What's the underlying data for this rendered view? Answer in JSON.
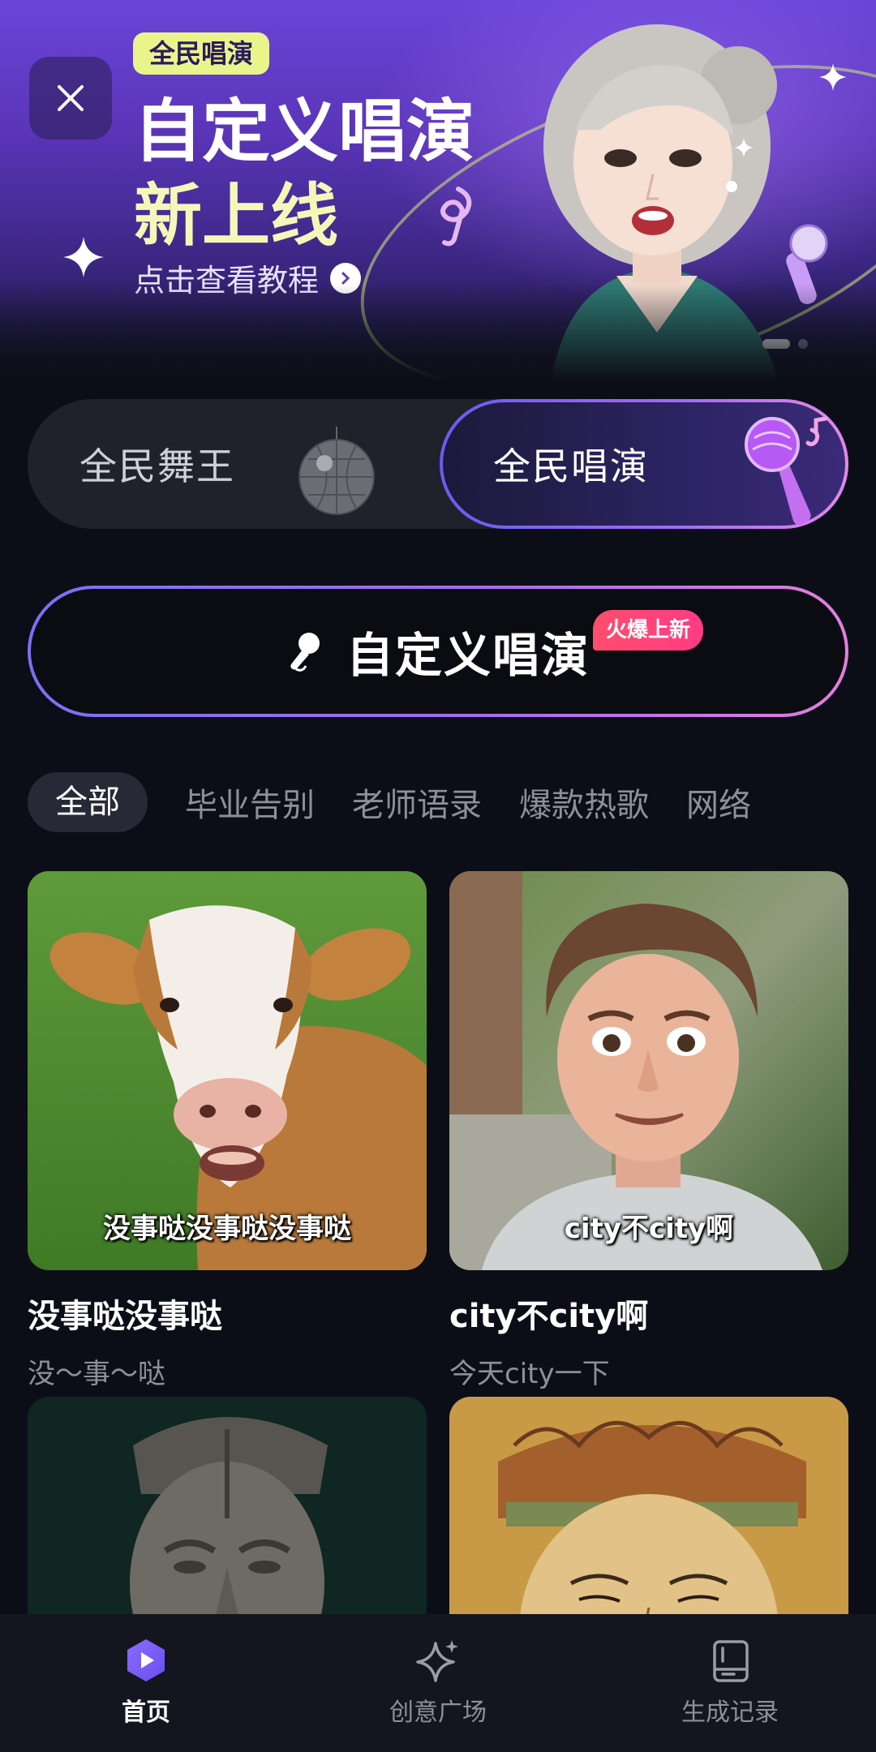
{
  "banner": {
    "tag": "全民唱演",
    "title_line1": "自定义唱演",
    "title_line2": "新上线",
    "cta": "点击查看教程",
    "page_index": 1,
    "page_count": 2
  },
  "mode_switch": {
    "left_label": "全民舞王",
    "right_label": "全民唱演",
    "selected": "全民唱演"
  },
  "custom_button": {
    "label": "自定义唱演",
    "badge": "火爆上新"
  },
  "tabs": [
    "全部",
    "毕业告别",
    "老师语录",
    "爆款热歌",
    "网络"
  ],
  "active_tab": "全部",
  "cards": [
    {
      "caption": "没事哒没事哒没事哒",
      "title": "没事哒没事哒",
      "subtitle": "没～事～哒"
    },
    {
      "caption": "city不city啊",
      "title": "city不city啊",
      "subtitle": "今天city一下"
    }
  ],
  "bottom_nav": [
    {
      "label": "首页",
      "icon": "play-hexagon-icon",
      "active": true
    },
    {
      "label": "创意广场",
      "icon": "sparkle-icon",
      "active": false
    },
    {
      "label": "生成记录",
      "icon": "record-card-icon",
      "active": false
    }
  ],
  "colors": {
    "background": "#0c0e17",
    "accent_purple": "#7b5cff",
    "gradient_pink": "#e27fdd",
    "badge_red": "#ff4d6d",
    "banner_yellow": "#e9f58a"
  }
}
